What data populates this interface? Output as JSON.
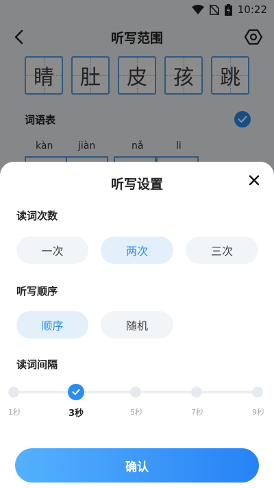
{
  "status_bar": {
    "time": "10:22"
  },
  "header": {
    "title": "听写范围"
  },
  "characters": [
    "睛",
    "肚",
    "皮",
    "孩",
    "跳"
  ],
  "word_list": {
    "label": "词语表"
  },
  "pinyin": [
    "kàn",
    "jiàn",
    "nǎ",
    "li"
  ],
  "sheet": {
    "title": "听写设置",
    "read_count": {
      "label": "读词次数",
      "options": [
        "一次",
        "两次",
        "三次"
      ],
      "selected": "两次"
    },
    "order": {
      "label": "听写顺序",
      "options": [
        "顺序",
        "随机"
      ],
      "selected": "顺序"
    },
    "interval": {
      "label": "读词间隔",
      "ticks": [
        "1秒",
        "3秒",
        "5秒",
        "7秒",
        "9秒"
      ],
      "selected": "3秒"
    },
    "confirm_label": "确认"
  },
  "colors": {
    "accent": "#2d8cf0",
    "box_border": "#5aa0e8"
  }
}
